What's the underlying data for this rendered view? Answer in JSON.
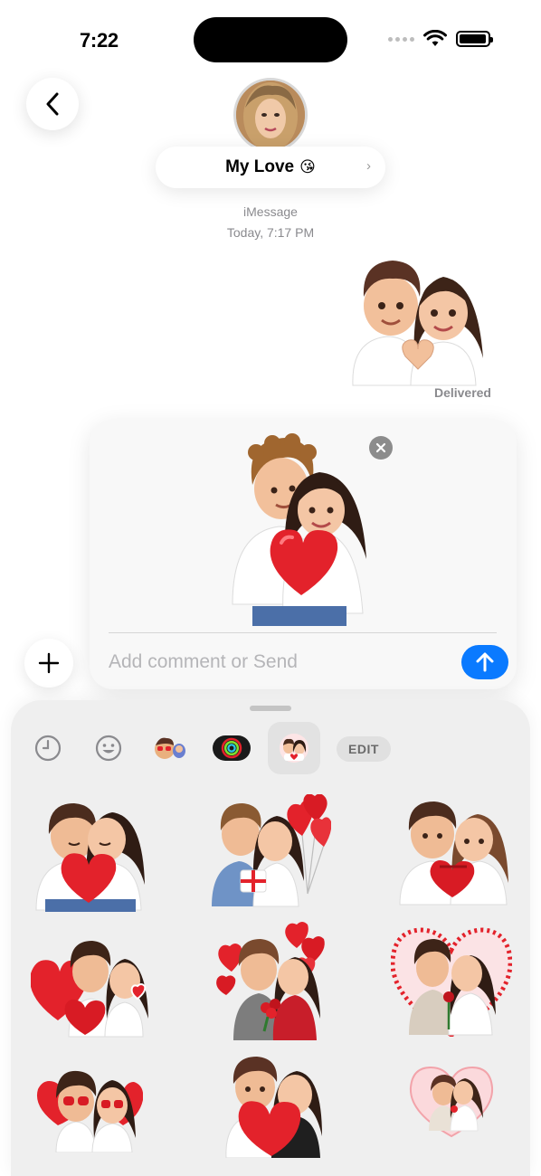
{
  "status_bar": {
    "time": "7:22",
    "battery_level": 0.95
  },
  "header": {
    "contact_name": "My Love",
    "contact_emoji": "😘",
    "chevron": "›"
  },
  "conversation": {
    "service": "iMessage",
    "timestamp": "Today, 7:17 PM",
    "delivery_status": "Delivered"
  },
  "compose": {
    "placeholder": "Add comment or Send"
  },
  "drawer": {
    "tabs": [
      {
        "name": "recents-clock-icon",
        "selected": false
      },
      {
        "name": "emoji-smiley-icon",
        "selected": false
      },
      {
        "name": "memoji-sticker-pack-icon",
        "selected": false
      },
      {
        "name": "activity-rings-icon",
        "selected": false
      },
      {
        "name": "couple-sticker-pack-icon",
        "selected": true
      }
    ],
    "edit_label": "EDIT"
  },
  "colors": {
    "accent_blue": "#0a7aff",
    "heart_red": "#e3222b",
    "drawer_bg": "#efefef"
  }
}
